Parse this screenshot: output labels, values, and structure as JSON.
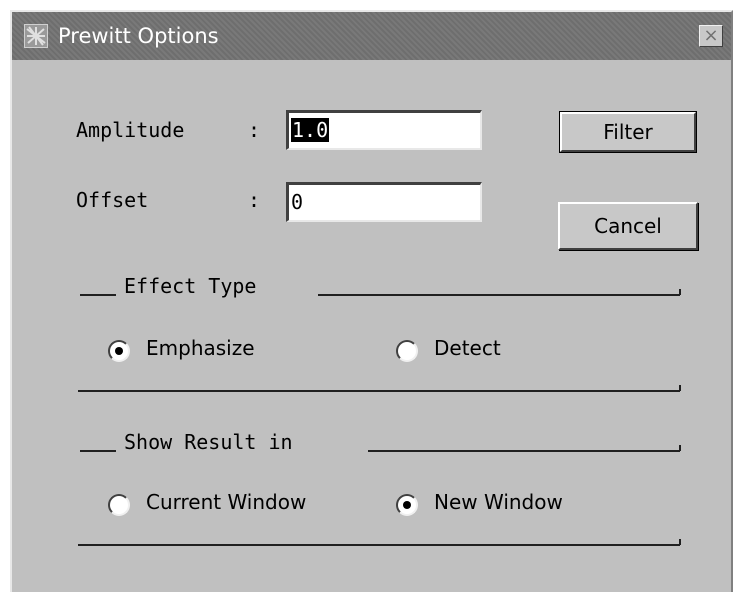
{
  "window": {
    "title": "Prewitt Options",
    "close_glyph": "×"
  },
  "fields": {
    "amplitude": {
      "label": "Amplitude",
      "colon": ":",
      "value": "1.0",
      "value_selected": true
    },
    "offset": {
      "label": "Offset",
      "colon": ":",
      "value": "0"
    }
  },
  "buttons": {
    "filter": "Filter",
    "cancel": "Cancel"
  },
  "effect_type": {
    "title": "Effect Type",
    "options": [
      {
        "label": "Emphasize",
        "selected": true
      },
      {
        "label": "Detect",
        "selected": false
      }
    ]
  },
  "show_result": {
    "title": "Show Result in",
    "options": [
      {
        "label": "Current Window",
        "selected": false
      },
      {
        "label": "New Window",
        "selected": true
      }
    ]
  }
}
